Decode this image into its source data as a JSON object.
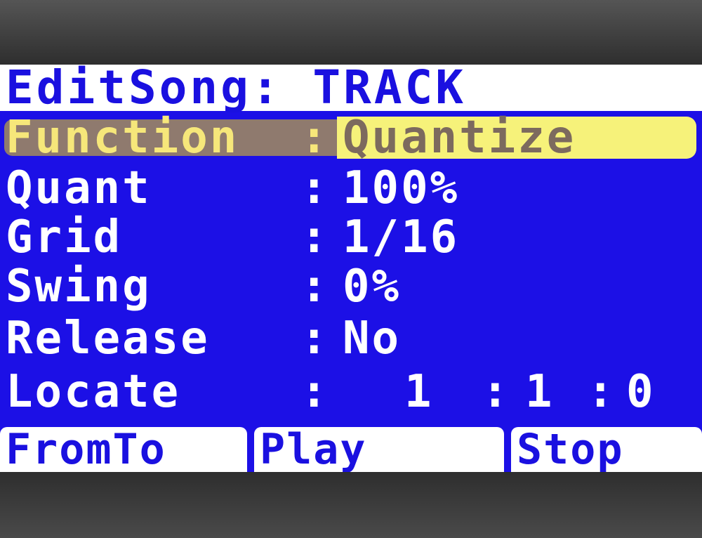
{
  "screen": {
    "title": "EditSong: TRACK",
    "rows": [
      {
        "label": "Function",
        "separator": ":",
        "value": "Quantize"
      },
      {
        "label": "Quant",
        "separator": ":",
        "value": "100%"
      },
      {
        "label": "Grid",
        "separator": ":",
        "value": "1/16"
      },
      {
        "label": "Swing",
        "separator": ":",
        "value": "0%"
      },
      {
        "label": "Release",
        "separator": ":",
        "value": "No"
      }
    ],
    "locate": {
      "label": "Locate",
      "separator": ":",
      "bar": "1",
      "beat": "1",
      "tick": "0"
    },
    "softkeys": [
      "FromTo",
      "Play",
      "Stop"
    ]
  },
  "colors": {
    "lcd_background": "#1c10e6",
    "text": "#ffffff",
    "highlight_value": "#f6f27a",
    "highlight_label": "#8f7a6e"
  }
}
